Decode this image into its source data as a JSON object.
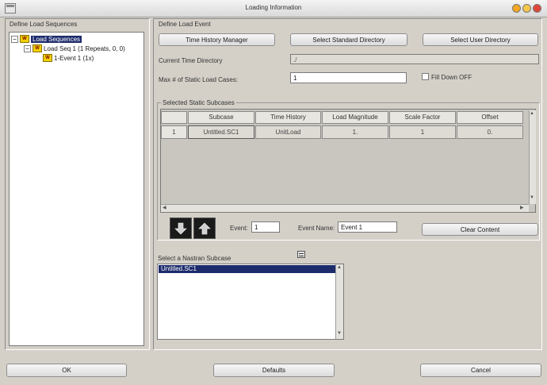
{
  "window": {
    "title": "Loading Information"
  },
  "left_panel": {
    "title": "Define Load Sequences",
    "tree": [
      {
        "label": "Load Sequences",
        "icon": "load-icon"
      },
      {
        "label": "Load Seq 1 (1 Repeats, 0, 0)",
        "icon": "load-icon"
      },
      {
        "label": "1-Event 1 (1x)",
        "icon": "load-icon"
      }
    ]
  },
  "right_panel": {
    "title": "Define Load Event",
    "buttons": {
      "time_history_manager": "Time History Manager",
      "select_standard_directory": "Select Standard Directory",
      "select_user_directory": "Select User Directory",
      "clear_content": "Clear Content"
    },
    "current_time_directory": {
      "label": "Current Time Directory",
      "value": "./"
    },
    "max_static_load_cases": {
      "label": "Max # of Static Load Cases:",
      "value": "1"
    },
    "fill_down": {
      "label": "Fill Down OFF",
      "checked": false
    },
    "subcases_group": {
      "title": "Selected Static Subcases",
      "columns": [
        "Subcase",
        "Time History",
        "Load Magnitude",
        "Scale Factor",
        "Offset"
      ],
      "rows": [
        {
          "index": "1",
          "cells": [
            "Untitled.SC1",
            "UnitLoad",
            "1.",
            "1",
            "0."
          ]
        }
      ]
    },
    "event": {
      "label": "Event:",
      "value": "1"
    },
    "event_name": {
      "label": "Event Name:",
      "value": "Event 1"
    },
    "nastran": {
      "title": "Select a Nastran Subcase",
      "items": [
        "Untitled.SC1"
      ]
    }
  },
  "bottom_buttons": {
    "ok": "OK",
    "defaults": "Defaults",
    "cancel": "Cancel"
  },
  "colors": {
    "selection": "#1c2b6b",
    "window_bg": "#d4d0c8"
  }
}
